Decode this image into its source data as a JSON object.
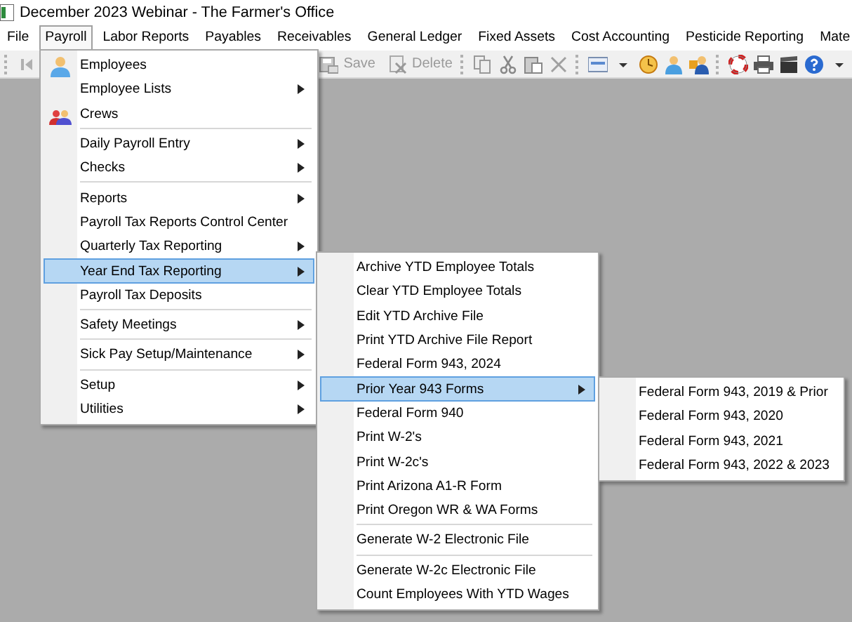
{
  "window": {
    "title": "December 2023 Webinar - The Farmer's Office"
  },
  "menu_bar": [
    {
      "label": "File",
      "selected": false
    },
    {
      "label": "Payroll",
      "selected": true
    },
    {
      "label": "Labor Reports",
      "selected": false
    },
    {
      "label": "Payables",
      "selected": false
    },
    {
      "label": "Receivables",
      "selected": false
    },
    {
      "label": "General Ledger",
      "selected": false
    },
    {
      "label": "Fixed Assets",
      "selected": false
    },
    {
      "label": "Cost Accounting",
      "selected": false
    },
    {
      "label": "Pesticide Reporting",
      "selected": false
    },
    {
      "label": "Mate",
      "selected": false
    }
  ],
  "toolbar": {
    "buttons": [
      {
        "label": "Save",
        "disabled": true
      },
      {
        "label": "Delete",
        "disabled": true
      }
    ]
  },
  "menus": [
    {
      "groups": [
        [
          {
            "label": "Employees",
            "kind": "person",
            "submenu": false,
            "selected": false
          },
          {
            "label": "Employee Lists",
            "kind": "plain",
            "submenu": true,
            "selected": false
          },
          {
            "label": "Crews",
            "kind": "group",
            "submenu": false,
            "selected": false
          }
        ],
        [
          {
            "label": "Daily Payroll Entry",
            "kind": "plain",
            "submenu": true,
            "selected": false
          },
          {
            "label": "Checks",
            "kind": "plain",
            "submenu": true,
            "selected": false
          }
        ],
        [
          {
            "label": "Reports",
            "kind": "plain",
            "submenu": true,
            "selected": false
          },
          {
            "label": "Payroll Tax Reports Control Center",
            "kind": "plain",
            "submenu": false,
            "selected": false
          },
          {
            "label": "Quarterly Tax Reporting",
            "kind": "plain",
            "submenu": true,
            "selected": false
          },
          {
            "label": "Year End Tax Reporting",
            "kind": "plain",
            "submenu": true,
            "selected": true
          },
          {
            "label": "Payroll Tax Deposits",
            "kind": "plain",
            "submenu": false,
            "selected": false
          }
        ],
        [
          {
            "label": "Safety Meetings",
            "kind": "plain",
            "submenu": true,
            "selected": false
          }
        ],
        [
          {
            "label": "Sick Pay Setup/Maintenance",
            "kind": "plain",
            "submenu": true,
            "selected": false
          }
        ],
        [
          {
            "label": "Setup",
            "kind": "plain",
            "submenu": true,
            "selected": false
          },
          {
            "label": "Utilities",
            "kind": "plain",
            "submenu": true,
            "selected": false
          }
        ]
      ]
    },
    {
      "groups": [
        [
          {
            "label": "Archive YTD Employee Totals",
            "kind": "plain",
            "submenu": false,
            "selected": false
          },
          {
            "label": "Clear YTD Employee Totals",
            "kind": "plain",
            "submenu": false,
            "selected": false
          },
          {
            "label": "Edit YTD Archive File",
            "kind": "plain",
            "submenu": false,
            "selected": false
          },
          {
            "label": "Print YTD Archive File Report",
            "kind": "plain",
            "submenu": false,
            "selected": false
          },
          {
            "label": "Federal Form 943, 2024",
            "kind": "plain",
            "submenu": false,
            "selected": false
          },
          {
            "label": "Prior Year 943 Forms",
            "kind": "plain",
            "submenu": true,
            "selected": true
          },
          {
            "label": "Federal Form 940",
            "kind": "plain",
            "submenu": false,
            "selected": false
          },
          {
            "label": "Print W-2's",
            "kind": "plain",
            "submenu": false,
            "selected": false
          },
          {
            "label": "Print W-2c's",
            "kind": "plain",
            "submenu": false,
            "selected": false
          },
          {
            "label": "Print Arizona A1-R Form",
            "kind": "plain",
            "submenu": false,
            "selected": false
          },
          {
            "label": "Print Oregon WR & WA Forms",
            "kind": "plain",
            "submenu": false,
            "selected": false
          }
        ],
        [
          {
            "label": "Generate W-2 Electronic File",
            "kind": "plain",
            "submenu": false,
            "selected": false
          }
        ],
        [
          {
            "label": "Generate W-2c Electronic File",
            "kind": "plain",
            "submenu": false,
            "selected": false
          },
          {
            "label": "Count Employees With YTD Wages",
            "kind": "plain",
            "submenu": false,
            "selected": false
          }
        ]
      ]
    },
    {
      "groups": [
        [
          {
            "label": "Federal Form 943, 2019 & Prior",
            "kind": "plain",
            "submenu": false,
            "selected": false
          },
          {
            "label": "Federal Form 943, 2020",
            "kind": "plain",
            "submenu": false,
            "selected": false
          },
          {
            "label": "Federal Form 943, 2021",
            "kind": "plain",
            "submenu": false,
            "selected": false
          },
          {
            "label": "Federal Form 943, 2022 & 2023",
            "kind": "plain",
            "submenu": false,
            "selected": false
          }
        ]
      ]
    }
  ]
}
